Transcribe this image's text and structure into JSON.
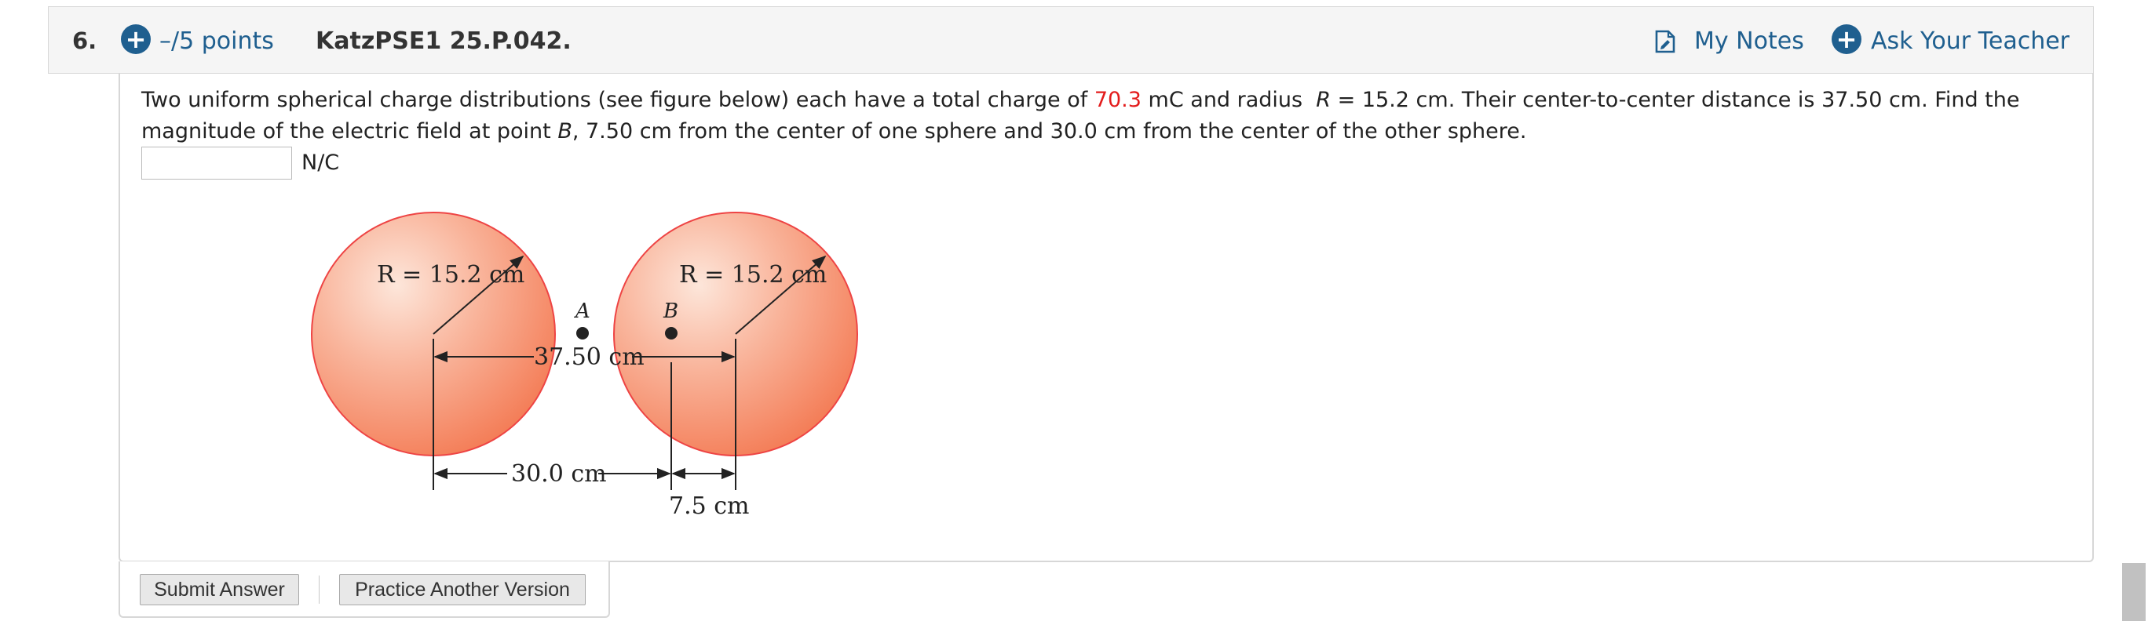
{
  "question": {
    "number": "6.",
    "points": "–/5 points",
    "id": "KatzPSE1 25.P.042.",
    "links": {
      "my_notes": "My Notes",
      "ask_teacher": "Ask Your Teacher"
    },
    "text": {
      "p1": "Two uniform spherical charge distributions (see figure below) each have a total charge of ",
      "charge": "70.3",
      "p2": " mC and radius ",
      "R": "R",
      "p3": " = 15.2 cm.  Their center-to-center distance is 37.50 cm. Find the magnitude of the electric field at point ",
      "B": "B",
      "p4": ", 7.50 cm from the center of one sphere and 30.0 cm from the center of the other sphere."
    },
    "answer": {
      "value": "",
      "unit": "N/C"
    }
  },
  "figure": {
    "left_radius_label": "R = 15.2 cm",
    "right_radius_label": "R = 15.2 cm",
    "point_a": "A",
    "point_b": "B",
    "center_distance": "37.50 cm",
    "dist_30": "30.0 cm",
    "dist_75": "7.5 cm",
    "colors": {
      "sphere_center": "#fde4d8",
      "sphere_edge": "#f58a66",
      "outline": "#f04040"
    }
  },
  "buttons": {
    "submit": "Submit Answer",
    "practice": "Practice Another Version"
  }
}
